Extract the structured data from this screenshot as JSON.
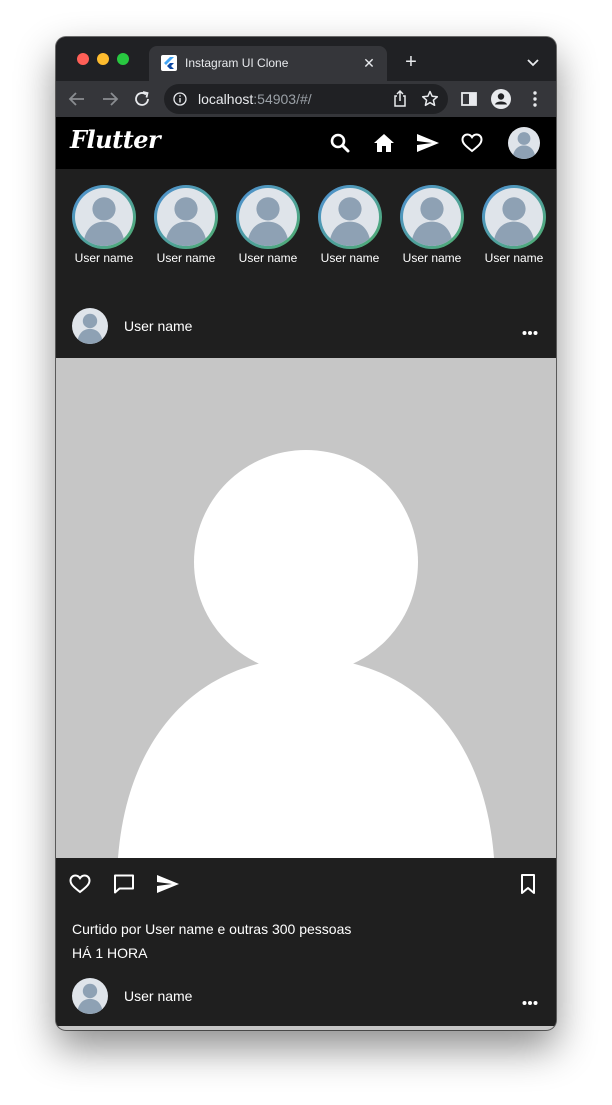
{
  "browser": {
    "tab_title": "Instagram UI Clone",
    "tab_close_glyph": "✕",
    "new_tab_glyph": "+",
    "url_host": "localhost",
    "url_rest": ":54903/#/"
  },
  "app": {
    "logo": "Flutter",
    "nav_icons": [
      "search-icon",
      "home-icon",
      "send-icon",
      "heart-icon",
      "profile-avatar"
    ]
  },
  "stories": [
    {
      "label": "User name"
    },
    {
      "label": "User name"
    },
    {
      "label": "User name"
    },
    {
      "label": "User name"
    },
    {
      "label": "User name"
    },
    {
      "label": "User name"
    }
  ],
  "posts": [
    {
      "username": "User name",
      "likes_text": "Curtido por User name e outras 300 pessoas",
      "time_text": "HÁ 1 HORA"
    },
    {
      "username": "User name"
    }
  ],
  "colors": {
    "app_bar": "#000000",
    "background": "#1f1f1f",
    "story_ring_start": "#4f8fd6",
    "story_ring_end": "#4fae6c",
    "image_placeholder": "#c6c6c6",
    "avatar_figure": "#8ea1b4"
  }
}
